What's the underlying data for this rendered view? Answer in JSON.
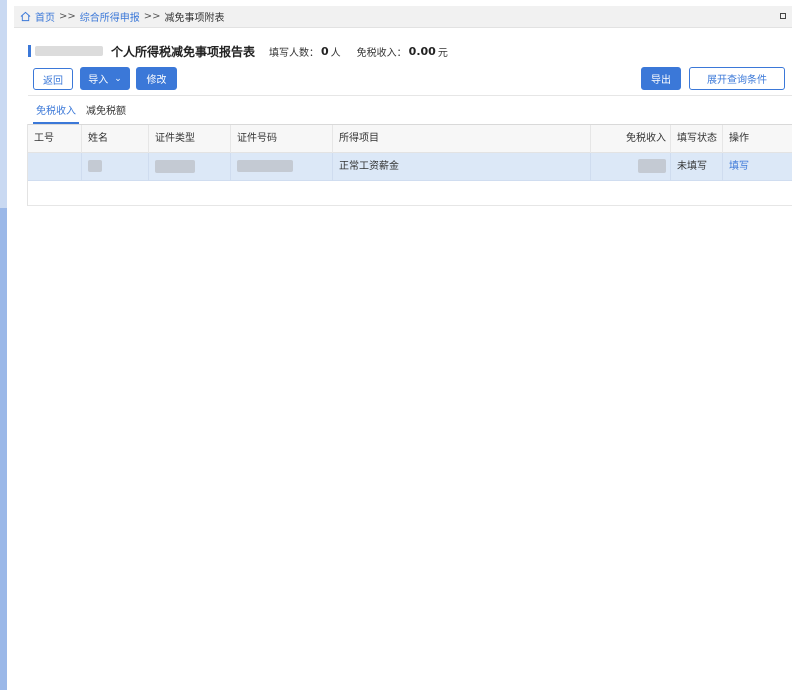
{
  "breadcrumb": {
    "home": "首页",
    "separator": ">>",
    "level1": "综合所得申报",
    "current": "减免事项附表"
  },
  "header": {
    "title": "个人所得税减免事项报告表",
    "filled_count_label": "填写人数：",
    "filled_count_value": "0",
    "filled_count_unit": "人",
    "tax_free_income_label": "免税收入：",
    "tax_free_income_value": "0.00",
    "tax_free_income_unit": "元"
  },
  "toolbar": {
    "back_label": "返回",
    "import_label": "导入",
    "edit_label": "修改",
    "export_label": "导出",
    "expand_query_label": "展开查询条件"
  },
  "tabs": [
    {
      "label": "免税收入",
      "active": true
    },
    {
      "label": "减免税额",
      "active": false
    }
  ],
  "table": {
    "columns": [
      "工号",
      "姓名",
      "证件类型",
      "证件号码",
      "所得项目",
      "免税收入",
      "填写状态",
      "操作"
    ],
    "rows": [
      {
        "income_item": "正常工资薪金",
        "status": "未填写",
        "action": "填写"
      }
    ]
  },
  "colors": {
    "accent": "#3b78d8",
    "row_highlight": "#dce8f7",
    "sidebar_strip": "#9bb8e8"
  }
}
